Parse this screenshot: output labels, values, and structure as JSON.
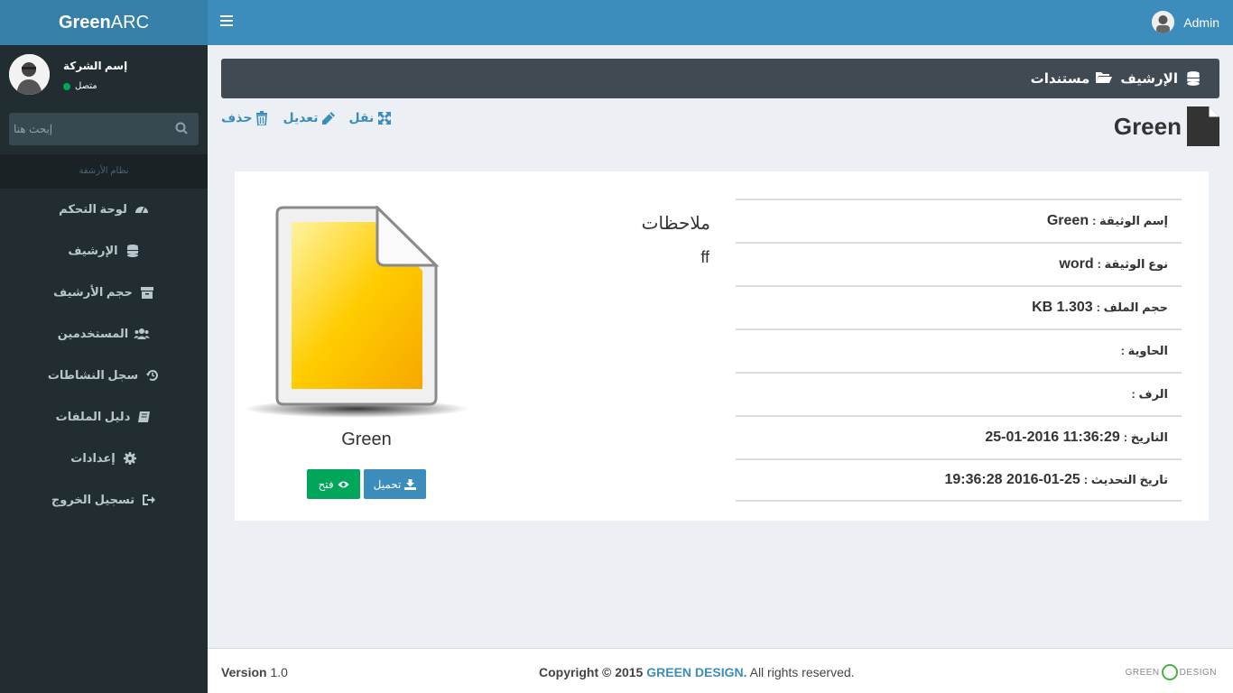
{
  "app": {
    "logo_bold": "Green",
    "logo_rest": "ARC"
  },
  "header": {
    "user_name": "Admin"
  },
  "sidebar": {
    "company_name": "إسم الشركة",
    "status": "متصل",
    "search_placeholder": "إبحث هنا",
    "nav_header": "نظام الأرشفة",
    "items": [
      {
        "label": "لوحة التحكم",
        "icon": "dashboard-icon"
      },
      {
        "label": "الإرشيف",
        "icon": "database-icon"
      },
      {
        "label": "حجم الأرشيف",
        "icon": "archive-box-icon"
      },
      {
        "label": "المستخدمين",
        "icon": "users-icon"
      },
      {
        "label": "سجل النشاطات",
        "icon": "history-icon"
      },
      {
        "label": "دليل الملفات",
        "icon": "book-icon"
      },
      {
        "label": "إعدادات",
        "icon": "gear-icon"
      },
      {
        "label": "تسجيل الخروج",
        "icon": "sign-out-icon"
      }
    ]
  },
  "breadcrumb": {
    "archive": "الإرشيف",
    "documents": "مستندات"
  },
  "actions": {
    "delete": "حذف",
    "edit": "تعديل",
    "move": "نقل"
  },
  "document": {
    "title": "Green",
    "notes_label": "ملاحظات",
    "notes_value": "ff",
    "file_name": "Green",
    "open_label": "فتح",
    "download_label": "تحميل",
    "fields": [
      {
        "key": "إسم الوثيقة :",
        "value": "Green"
      },
      {
        "key": "نوع الوثيقة :",
        "value": "word"
      },
      {
        "key": "حجم الملف :",
        "value": "KB 1.303"
      },
      {
        "key": "الحاوية :",
        "value": ""
      },
      {
        "key": "الرف :",
        "value": ""
      },
      {
        "key": "التاريخ :",
        "value": "11:36:29 25-01-2016"
      },
      {
        "key": "تاريخ التحديث :",
        "value": "2016-01-25 19:36:28"
      }
    ]
  },
  "footer": {
    "version_label": "Version",
    "version": "1.0",
    "copyright": "Copyright © 2015",
    "brand": "GREEN DESIGN.",
    "rights": "All rights reserved.",
    "logo_left": "GREEN",
    "logo_right": "DESIGN"
  },
  "colors": {
    "primary": "#3c8dbc",
    "sidebar": "#222d32",
    "success": "#00a65a"
  }
}
